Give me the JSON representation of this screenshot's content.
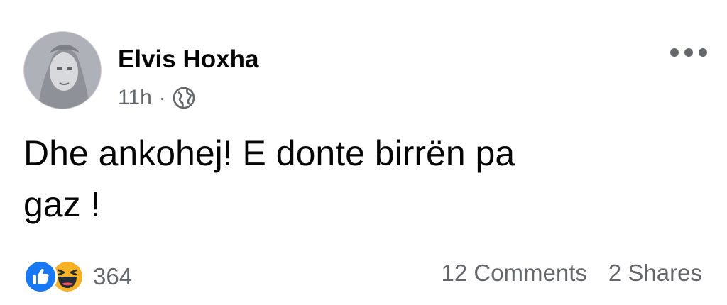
{
  "post": {
    "author": "Elvis Hoxha",
    "time": "11h",
    "separator": "·",
    "audience_icon": "globe-icon",
    "text_line1": "Dhe ankohej! E donte birrën pa",
    "text_line2": "gaz !",
    "reaction_icons": [
      "like-icon",
      "haha-icon"
    ],
    "reaction_count": "364",
    "comments": "12 Comments",
    "shares": "2 Shares"
  },
  "colors": {
    "text": "#050505",
    "secondary": "#65676b",
    "like_blue": "#1877f2",
    "haha_yellow": "#f7b125"
  }
}
